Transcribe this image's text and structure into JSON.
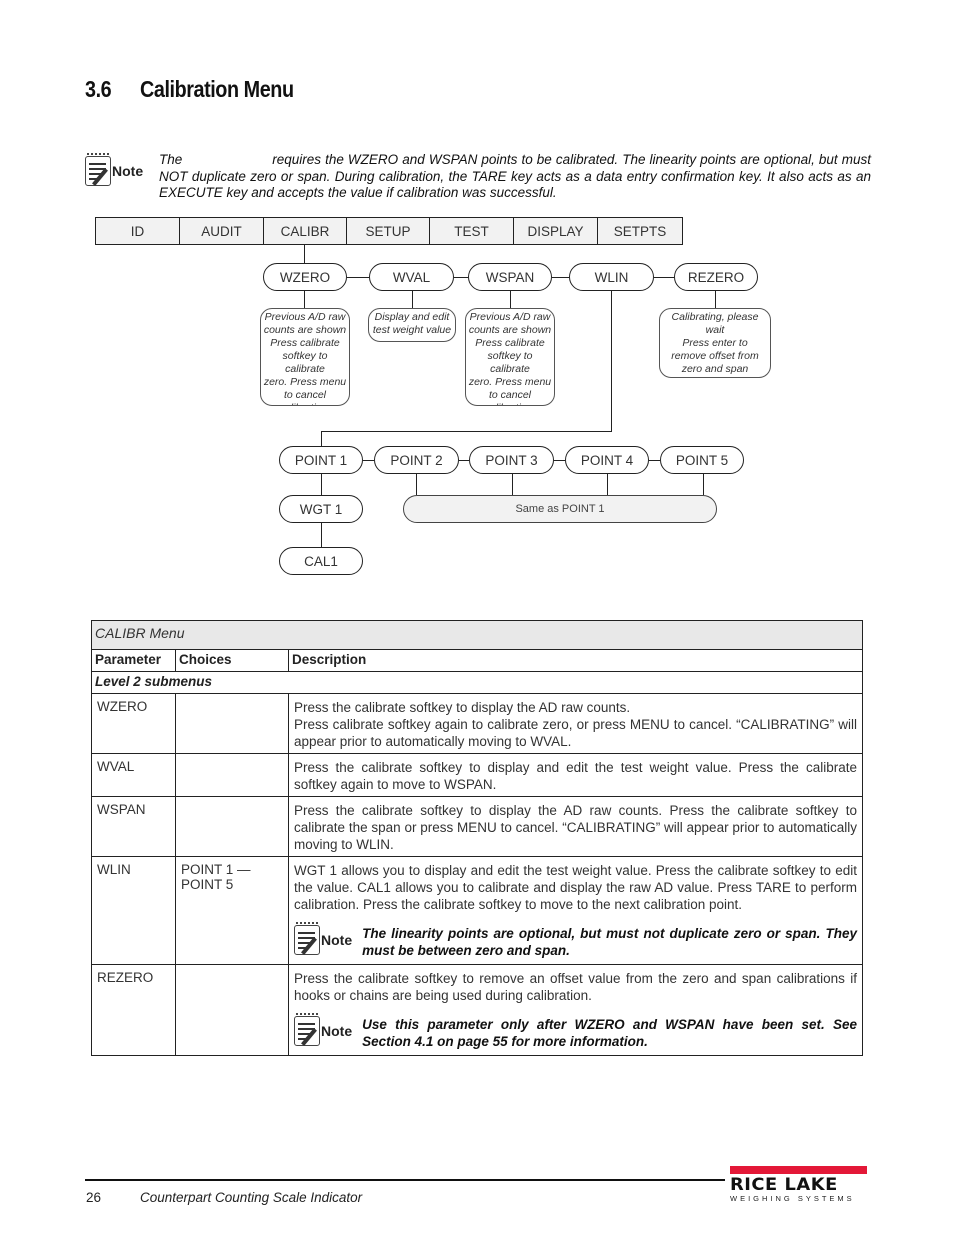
{
  "section": {
    "number": "3.6",
    "title": "Calibration Menu"
  },
  "top_note": {
    "icon": "note-icon",
    "label": "Note",
    "lead": "The",
    "text": "requires the WZERO and WSPAN points to be calibrated. The linearity points are optional, but must NOT duplicate zero or span. During calibration, the TARE key acts as a data entry confirmation key. It also acts as an EXECUTE key and accepts the value if calibration was successful."
  },
  "diagram": {
    "menu_bar": [
      "ID",
      "AUDIT",
      "CALIBR",
      "SETUP",
      "TEST",
      "DISPLAY",
      "SETPTS"
    ],
    "level2": [
      "WZERO",
      "WVAL",
      "WSPAN",
      "WLIN",
      "REZERO"
    ],
    "descriptions": {
      "wzero": "Previous A/D raw\ncounts are shown\nPress calibrate\nsoftkey to calibrate\nzero. Press menu\nto cancel\ncalibrating.",
      "wval": "Display and edit\ntest weight value",
      "wspan": "Previous A/D raw\ncounts are shown\nPress calibrate\nsoftkey to calibrate\nzero. Press menu\nto cancel\ncalibrating.",
      "rezero": "Calibrating, please wait\nPress enter to\nremove offset from\nzero and span\ncalibrations"
    },
    "points": [
      "POINT 1",
      "POINT 2",
      "POINT 3",
      "POINT 4",
      "POINT 5"
    ],
    "point1_children": [
      "WGT 1",
      "CAL1"
    ],
    "same_as": "Same as POINT 1"
  },
  "table": {
    "caption": "CALIBR Menu",
    "headers": [
      "Parameter",
      "Choices",
      "Description"
    ],
    "level_label": "Level 2 submenus",
    "rows": [
      {
        "param": "WZERO",
        "choices": "",
        "desc1": "Press the calibrate softkey to display the AD raw counts.",
        "desc2": "Press calibrate softkey again to calibrate zero, or press MENU to cancel. “CALIBRATING” will appear prior to automatically moving to WVAL."
      },
      {
        "param": "WVAL",
        "choices": "",
        "desc1": "Press the calibrate softkey to display and edit the test weight value. Press the calibrate softkey again to move to WSPAN."
      },
      {
        "param": "WSPAN",
        "choices": "",
        "desc1": "Press the calibrate softkey to display the AD raw counts. Press the calibrate softkey to calibrate the span or press MENU to cancel. “CALIBRATING” will appear prior to automatically moving to WLIN."
      },
      {
        "param": "WLIN",
        "choices_line1": "POINT 1 —",
        "choices_line2": "POINT 5",
        "desc1": "WGT 1 allows you to display and edit the test weight value. Press the calibrate softkey to edit the value. CAL1 allows you to calibrate and display the raw AD value. Press TARE to perform calibration. Press the calibrate softkey to move to the next calibration point.",
        "note_label": "Note",
        "note": "The linearity points are optional, but must not duplicate zero or span. They must be between zero and span."
      },
      {
        "param": "REZERO",
        "choices": "",
        "desc1": "Press the calibrate softkey to remove an offset value from the zero and span calibrations if hooks or chains are being used during calibration.",
        "note_label": "Note",
        "note": "Use this parameter only after WZERO and WSPAN have been set. See Section 4.1 on page 55 for more information."
      }
    ]
  },
  "footer": {
    "page_number": "26",
    "doc_title": "Counterpart Counting Scale Indicator",
    "logo_brand": "RICE LAKE",
    "logo_sub": "WEIGHING SYSTEMS",
    "logo_color": "#e31837"
  }
}
